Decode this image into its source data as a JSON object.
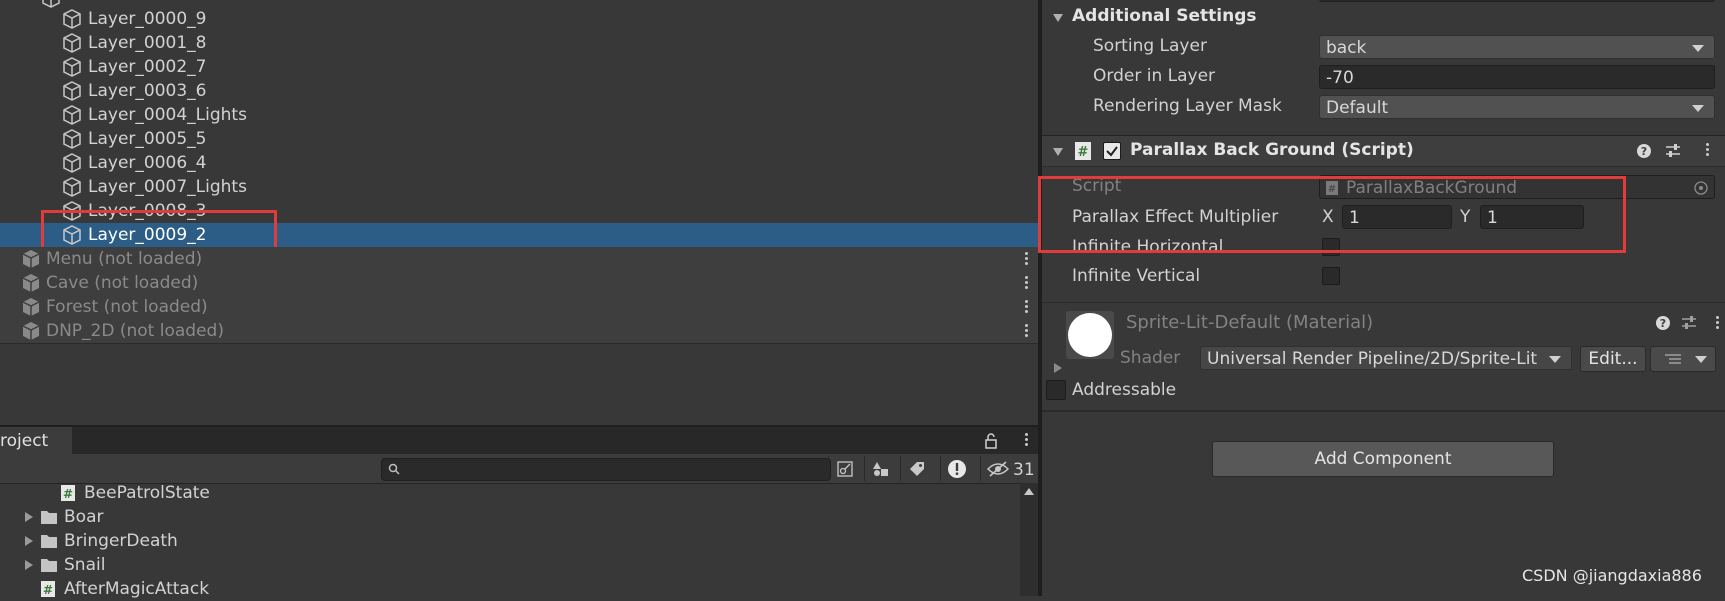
{
  "hierarchy": {
    "layers": [
      {
        "label": "Layer_0000_9"
      },
      {
        "label": "Layer_0001_8"
      },
      {
        "label": "Layer_0002_7"
      },
      {
        "label": "Layer_0003_6"
      },
      {
        "label": "Layer_0004_Lights"
      },
      {
        "label": "Layer_0005_5"
      },
      {
        "label": "Layer_0006_4"
      },
      {
        "label": "Layer_0007_Lights"
      },
      {
        "label": "Layer_0008_3"
      },
      {
        "label": "Layer_0009_2"
      }
    ],
    "selected_index": 9,
    "scenes": [
      {
        "label": "Menu (not loaded)"
      },
      {
        "label": "Cave (not loaded)"
      },
      {
        "label": "Forest (not loaded)"
      },
      {
        "label": "DNP_2D (not loaded)"
      }
    ]
  },
  "project": {
    "tab_label": "roject",
    "visible_count": "31",
    "items": [
      {
        "label": "BeePatrolState",
        "type": "script"
      },
      {
        "label": "Boar",
        "type": "folder"
      },
      {
        "label": "BringerDeath",
        "type": "folder"
      },
      {
        "label": "Snail",
        "type": "folder"
      },
      {
        "label": "AfterMagicAttack",
        "type": "script"
      }
    ]
  },
  "inspector": {
    "additional_settings": {
      "title": "Additional Settings",
      "sorting_layer_label": "Sorting Layer",
      "sorting_layer_value": "back",
      "order_label": "Order in Layer",
      "order_value": "-70",
      "rendering_mask_label": "Rendering Layer Mask",
      "rendering_mask_value": "Default"
    },
    "parallax": {
      "title": "Parallax Back Ground (Script)",
      "script_label": "Script",
      "script_value": "ParallaxBackGround",
      "multiplier_label": "Parallax Effect Multiplier",
      "x_label": "X",
      "x_value": "1",
      "y_label": "Y",
      "y_value": "1",
      "inf_h_label": "Infinite Horizontal",
      "inf_v_label": "Infinite Vertical"
    },
    "material": {
      "title": "Sprite-Lit-Default (Material)",
      "shader_label": "Shader",
      "shader_value": "Universal Render Pipeline/2D/Sprite-Lit",
      "edit_label": "Edit..."
    },
    "addressable_label": "Addressable",
    "add_component_label": "Add Component"
  },
  "watermark": "CSDN @jiangdaxia886",
  "colors": {
    "background": "#383838",
    "selection": "#2c5d87",
    "highlight_box": "#e03c3c"
  }
}
